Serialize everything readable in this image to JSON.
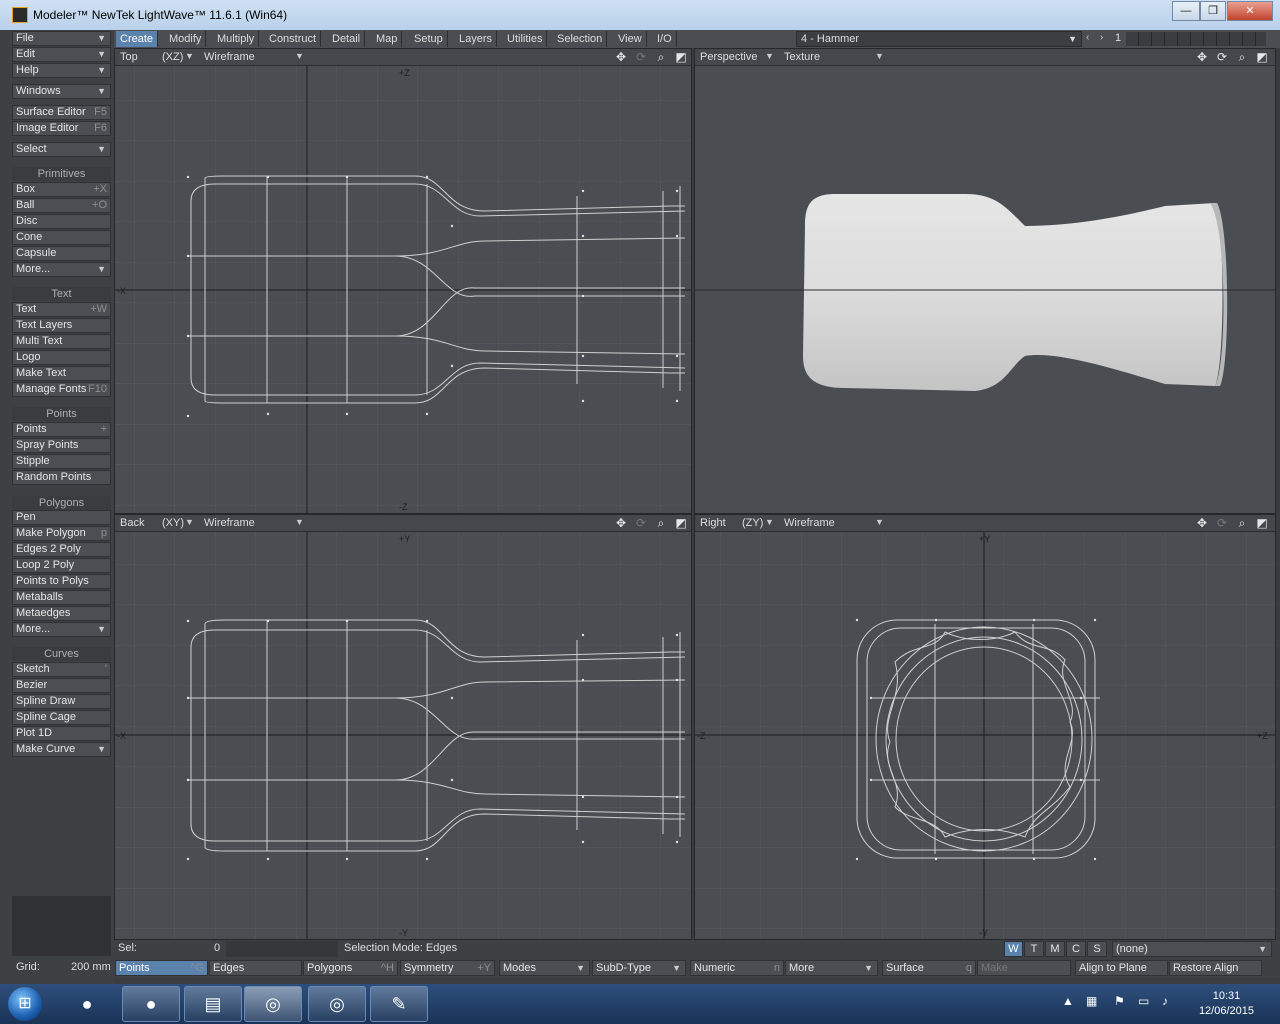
{
  "window": {
    "title": "Modeler™ NewTek LightWave™ 11.6.1 (Win64)",
    "minimize": "—",
    "maximize": "❐",
    "close": "✕"
  },
  "tabs": [
    "Create",
    "Modify",
    "Multiply",
    "Construct",
    "Detail",
    "Map",
    "Setup",
    "Layers",
    "Utilities",
    "Selection",
    "View",
    "I/O"
  ],
  "active_tab": "Create",
  "layer": {
    "name": "4 - Hammer",
    "number": "1"
  },
  "toolbar": {
    "file": "File",
    "edit": "Edit",
    "help": "Help",
    "windows": "Windows",
    "surface_editor": "Surface Editor",
    "surface_editor_key": "F5",
    "image_editor": "Image Editor",
    "image_editor_key": "F6",
    "select": "Select",
    "primitives": {
      "label": "Primitives",
      "items": [
        {
          "label": "Box",
          "key": "+X"
        },
        {
          "label": "Ball",
          "key": "+O"
        },
        {
          "label": "Disc",
          "key": ""
        },
        {
          "label": "Cone",
          "key": ""
        },
        {
          "label": "Capsule",
          "key": ""
        },
        {
          "label": "More...",
          "key": ""
        }
      ]
    },
    "text": {
      "label": "Text",
      "items": [
        {
          "label": "Text",
          "key": "+W"
        },
        {
          "label": "Text Layers",
          "key": ""
        },
        {
          "label": "Multi Text",
          "key": ""
        },
        {
          "label": "Logo",
          "key": ""
        },
        {
          "label": "Make Text",
          "key": ""
        },
        {
          "label": "Manage Fonts",
          "key": "F10"
        }
      ]
    },
    "points": {
      "label": "Points",
      "items": [
        {
          "label": "Points",
          "key": "+"
        },
        {
          "label": "Spray Points",
          "key": ""
        },
        {
          "label": "Stipple",
          "key": ""
        },
        {
          "label": "Random Points",
          "key": ""
        }
      ]
    },
    "polygons": {
      "label": "Polygons",
      "items": [
        {
          "label": "Pen",
          "key": ""
        },
        {
          "label": "Make Polygon",
          "key": "p"
        },
        {
          "label": "Edges 2 Poly",
          "key": ""
        },
        {
          "label": "Loop 2 Poly",
          "key": ""
        },
        {
          "label": "Points to Polys",
          "key": ""
        },
        {
          "label": "Metaballs",
          "key": ""
        },
        {
          "label": "Metaedges",
          "key": ""
        },
        {
          "label": "More...",
          "key": ""
        }
      ]
    },
    "curves": {
      "label": "Curves",
      "items": [
        {
          "label": "Sketch",
          "key": "'"
        },
        {
          "label": "Bezier",
          "key": ""
        },
        {
          "label": "Spline Draw",
          "key": ""
        },
        {
          "label": "Spline Cage",
          "key": ""
        },
        {
          "label": "Plot 1D",
          "key": ""
        },
        {
          "label": "Make Curve",
          "key": ""
        }
      ]
    }
  },
  "viewports": {
    "top": {
      "view": "Top",
      "axis": "(XZ)",
      "mode": "Wireframe",
      "axis_top": "+Z",
      "axis_bottom": "-Z",
      "axis_left": "-X"
    },
    "perspective": {
      "view": "Perspective",
      "mode": "Texture"
    },
    "back": {
      "view": "Back",
      "axis": "(XY)",
      "mode": "Wireframe",
      "axis_top": "+Y",
      "axis_bottom": "-Y",
      "axis_left": "-X"
    },
    "right": {
      "view": "Right",
      "axis": "(ZY)",
      "mode": "Wireframe",
      "axis_top": "+Y",
      "axis_bottom": "-Y",
      "axis_left": "-Z",
      "axis_right": "+Z"
    }
  },
  "viewport_icons": {
    "move": "✥",
    "rotate": "⟳",
    "zoom": "⌕",
    "maximize": "◩"
  },
  "status": {
    "sel_label": "Sel:",
    "sel_value": "0",
    "selection_mode": "Selection Mode:  Edges",
    "wtmcs": [
      "W",
      "T",
      "M",
      "C",
      "S"
    ],
    "surface": "(none)"
  },
  "bottom": {
    "grid_label": "Grid:",
    "grid_value": "200 mm",
    "points": "Points",
    "points_key": "^G",
    "edges": "Edges",
    "polygons": "Polygons",
    "polygons_key": "^H",
    "symmetry": "Symmetry",
    "symmetry_key": "+Y",
    "modes": "Modes",
    "subd": "SubD-Type",
    "numeric": "Numeric",
    "numeric_key": "n",
    "more": "More",
    "surface": "Surface",
    "surface_key": "q",
    "make": "Make",
    "align_plane": "Align to Plane",
    "restore_align": "Restore Align"
  },
  "taskbar": {
    "time": "10:31",
    "date": "12/06/2015",
    "start": "⊞"
  },
  "colors": {
    "accent": "#5a82ad",
    "viewport_bg": "#4a4e53",
    "wire": "#d0d0d0"
  }
}
